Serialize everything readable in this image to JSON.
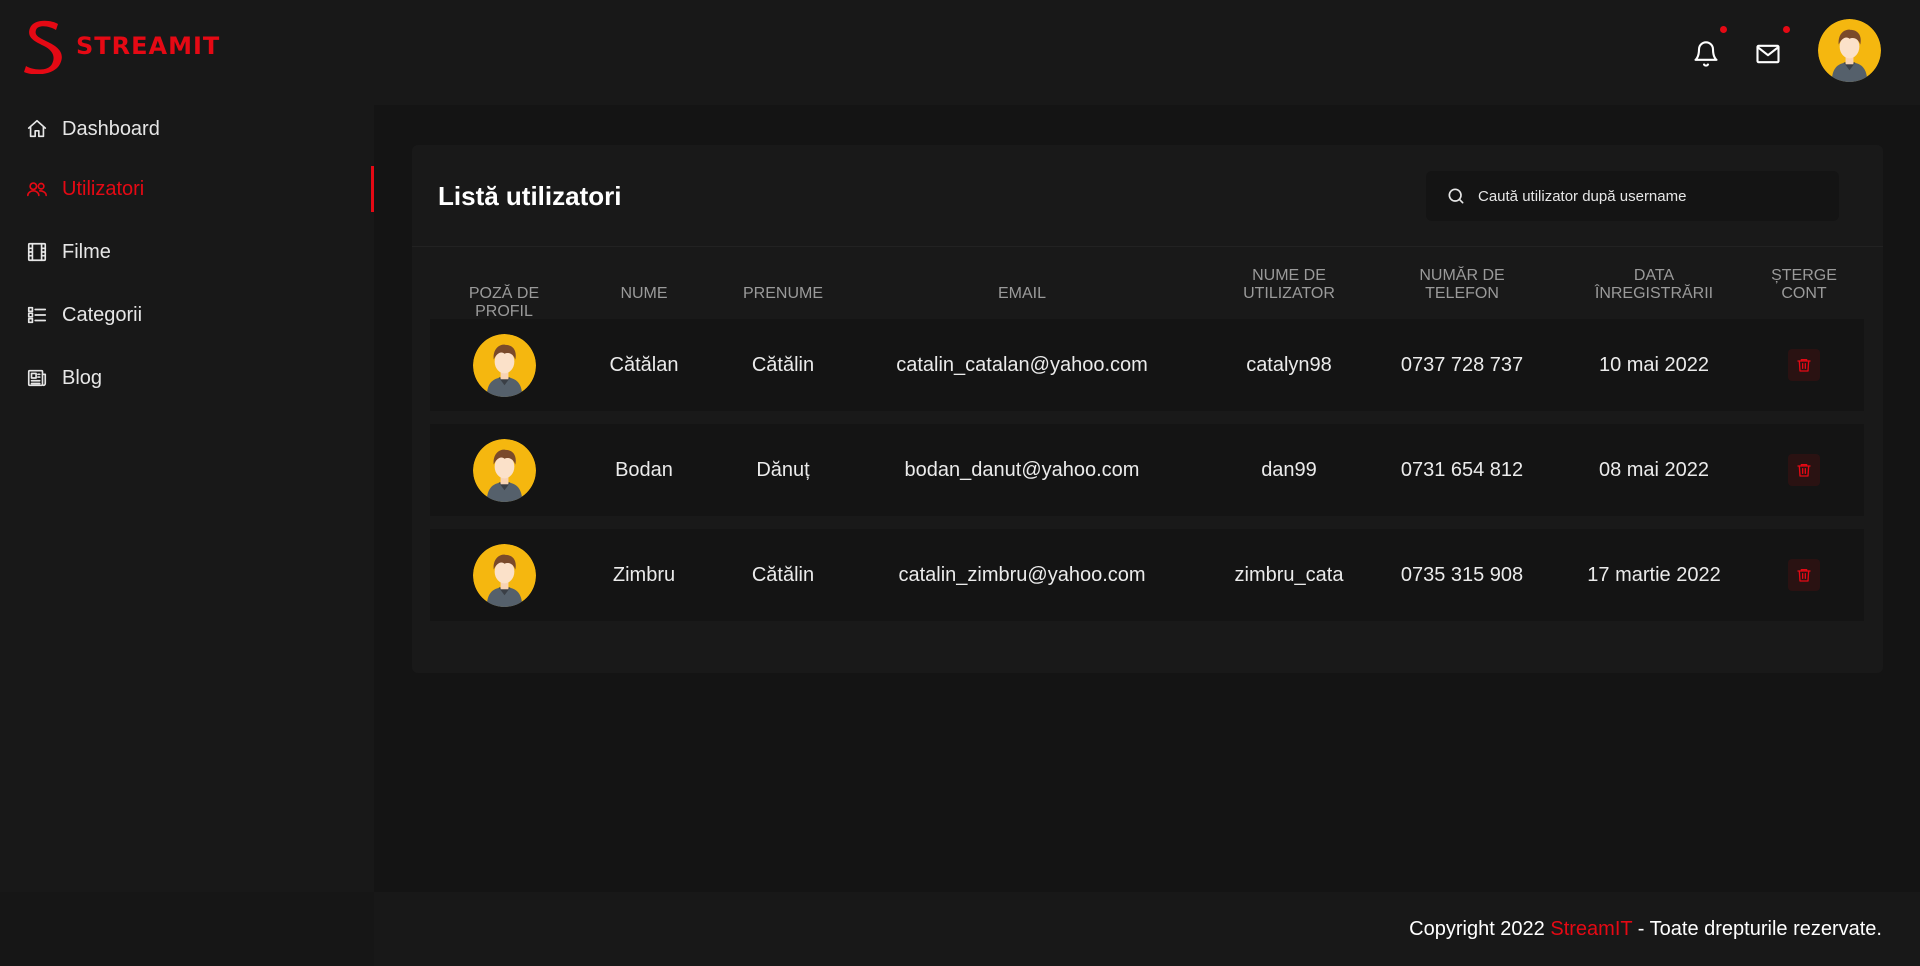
{
  "brand": {
    "name": "STREAMIT",
    "accent_color": "#e50914"
  },
  "header": {
    "icons": [
      "bell-icon",
      "mail-icon"
    ],
    "avatar": "user-avatar"
  },
  "sidebar": {
    "items": [
      {
        "label": "Dashboard",
        "icon": "home-icon",
        "active": false
      },
      {
        "label": "Utilizatori",
        "icon": "users-icon",
        "active": true
      },
      {
        "label": "Filme",
        "icon": "film-icon",
        "active": false
      },
      {
        "label": "Categorii",
        "icon": "list-icon",
        "active": false
      },
      {
        "label": "Blog",
        "icon": "newspaper-icon",
        "active": false
      }
    ]
  },
  "main": {
    "title": "Listă utilizatori",
    "search": {
      "placeholder": "Caută utilizator după username",
      "value": ""
    },
    "columns": [
      {
        "line1": "POZĂ DE PROFIL",
        "line2": ""
      },
      {
        "line1": "NUME",
        "line2": ""
      },
      {
        "line1": "PRENUME",
        "line2": ""
      },
      {
        "line1": "EMAIL",
        "line2": ""
      },
      {
        "line1": "NUME DE",
        "line2": "UTILIZATOR"
      },
      {
        "line1": "NUMĂR DE",
        "line2": "TELEFON"
      },
      {
        "line1": "DATA",
        "line2": "ÎNREGISTRĂRII"
      },
      {
        "line1": "ȘTERGE",
        "line2": "CONT"
      }
    ],
    "rows": [
      {
        "nume": "Cătălan",
        "prenume": "Cătălin",
        "email": "catalin_catalan@yahoo.com",
        "username": "catalyn98",
        "telefon": "0737 728 737",
        "data": "10 mai 2022"
      },
      {
        "nume": "Bodan",
        "prenume": "Dănuț",
        "email": "bodan_danut@yahoo.com",
        "username": "dan99",
        "telefon": "0731 654 812",
        "data": "08 mai 2022"
      },
      {
        "nume": "Zimbru",
        "prenume": "Cătălin",
        "email": "catalin_zimbru@yahoo.com",
        "username": "zimbru_cata",
        "telefon": "0735 315 908",
        "data": "17 martie 2022"
      }
    ]
  },
  "footer": {
    "prefix": "Copyright 2022 ",
    "brand": "StreamIT",
    "suffix": " - Toate drepturile rezervate."
  }
}
